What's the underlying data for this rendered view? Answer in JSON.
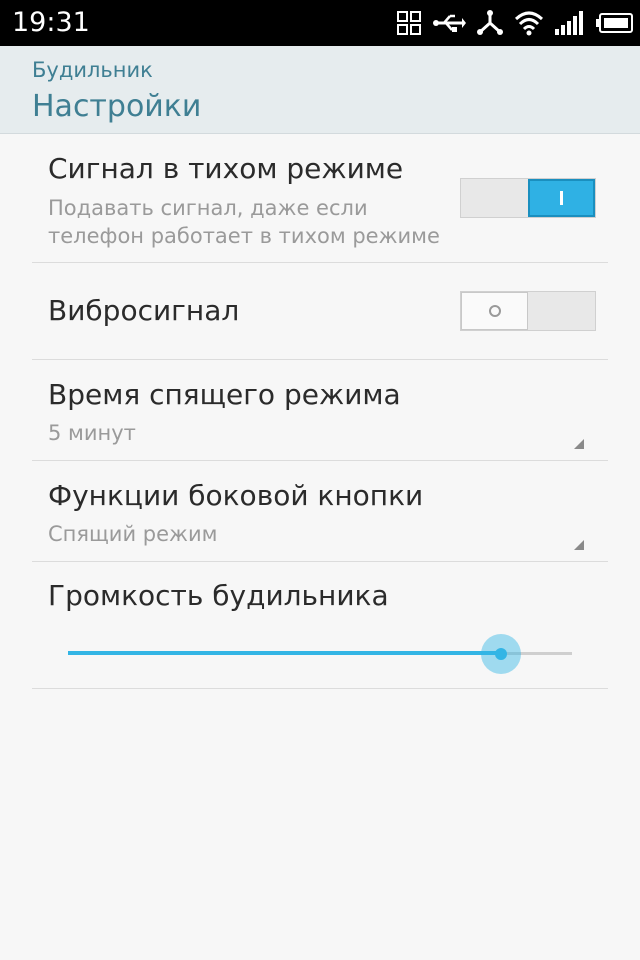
{
  "status_bar": {
    "time": "19:31",
    "icons": [
      "apps-grid-icon",
      "usb-icon",
      "share-icon",
      "wifi-icon",
      "signal-icon",
      "battery-icon"
    ]
  },
  "action_bar": {
    "app_name": "Будильник",
    "title": "Настройки"
  },
  "settings": {
    "silent_alarm": {
      "title": "Сигнал в тихом режиме",
      "summary": "Подавать сигнал, даже если телефон работает в тихом режиме",
      "enabled": true
    },
    "vibrate": {
      "title": "Вибросигнал",
      "enabled": false
    },
    "snooze_time": {
      "title": "Время спящего режима",
      "value": "5 минут"
    },
    "side_button": {
      "title": "Функции боковой кнопки",
      "value": "Спящий режим"
    },
    "alarm_volume": {
      "title": "Громкость будильника",
      "level": 0.86
    }
  },
  "colors": {
    "accent": "#33b5e5",
    "header_text": "#3f7f93",
    "header_bg": "#e6ecee"
  }
}
